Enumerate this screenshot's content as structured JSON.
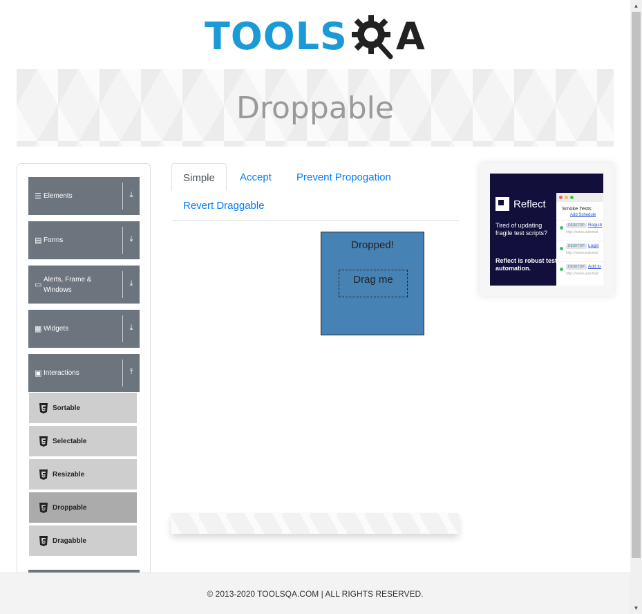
{
  "logo": {
    "text_main": "TOOLS",
    "text_q": "Q",
    "text_a": "A",
    "main_color": "#1a9bd7",
    "dark_color": "#222222"
  },
  "banner": {
    "title": "Droppable"
  },
  "sidebar": {
    "groups": [
      {
        "label": "Elements",
        "icon": "menu-icon",
        "arrow": "download-arrow-icon"
      },
      {
        "label": "Forms",
        "icon": "document-icon",
        "arrow": "download-arrow-icon"
      },
      {
        "label": "Alerts, Frame & Windows",
        "icon": "window-icon",
        "arrow": "download-arrow-icon"
      },
      {
        "label": "Widgets",
        "icon": "grid-icon",
        "arrow": "download-arrow-icon"
      },
      {
        "label": "Interactions",
        "icon": "list-icon",
        "arrow": "upload-arrow-icon"
      }
    ],
    "items": [
      {
        "label": "Sortable",
        "active": false
      },
      {
        "label": "Selectable",
        "active": false
      },
      {
        "label": "Resizable",
        "active": false
      },
      {
        "label": "Droppable",
        "active": true
      },
      {
        "label": "Dragabble",
        "active": false
      }
    ]
  },
  "tabs": [
    {
      "label": "Simple",
      "active": true
    },
    {
      "label": "Accept",
      "active": false
    },
    {
      "label": "Prevent Propogation",
      "active": false
    },
    {
      "label": "Revert Draggable",
      "active": false
    }
  ],
  "droppable": {
    "status_text": "Dropped!",
    "drag_text": "Drag me",
    "color": "#4682b4"
  },
  "ad": {
    "brand": "Reflect",
    "text1": "Tired of updating fragile test scripts?",
    "text2": "Reflect is robust test automation.",
    "shot_title": "Smoke Tests",
    "shot_link": "Add Schedule",
    "rows": [
      {
        "tag": "DESKTOP",
        "name": "Registr",
        "url": "http://www.automat"
      },
      {
        "tag": "DESKTOP",
        "name": "Login",
        "url": "http://www.automat"
      },
      {
        "tag": "DESKTOP",
        "name": "Add to",
        "url": "http://www.automat"
      }
    ]
  },
  "footer": {
    "text": "© 2013-2020 TOOLSQA.COM | ALL RIGHTS RESERVED."
  }
}
